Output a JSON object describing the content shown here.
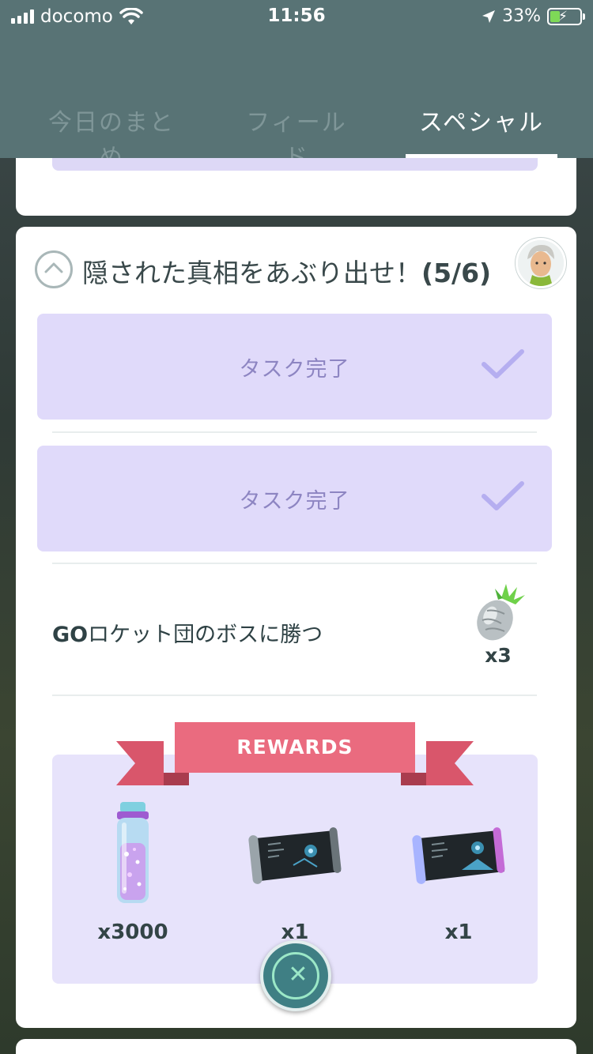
{
  "status_bar": {
    "carrier": "docomo",
    "time": "11:56",
    "battery_percent": "33%",
    "battery_level": 0.33,
    "icons": [
      "signal-icon",
      "wifi-icon",
      "location-arrow-icon",
      "battery-charging-icon"
    ]
  },
  "tabs": [
    {
      "label": "今日のまとめ",
      "active": false
    },
    {
      "label": "フィールド",
      "active": false
    },
    {
      "label": "スペシャル",
      "active": true
    }
  ],
  "quest": {
    "title": "隠された真相をあぶり出せ！",
    "progress": "(5/6)",
    "tasks": [
      {
        "label": "タスク完了",
        "completed": true
      },
      {
        "label": "タスク完了",
        "completed": true
      }
    ],
    "open_task": {
      "label_bold": "GO",
      "label_rest": "ロケット団のボスに勝つ",
      "reward_icon": "silver-pinap-berry-icon",
      "reward_qty": "x3"
    },
    "rewards_label": "REWARDS",
    "rewards": [
      {
        "icon": "stardust-icon",
        "qty": "x3000"
      },
      {
        "icon": "scroll-icon",
        "qty": "x1"
      },
      {
        "icon": "scroll-icon",
        "qty": "x1"
      }
    ]
  },
  "colors": {
    "header_bg": "#587375",
    "task_done_bg": "#e0dafa",
    "ribbon": "#ea6b7f",
    "fab_bg": "#3f7f84"
  }
}
